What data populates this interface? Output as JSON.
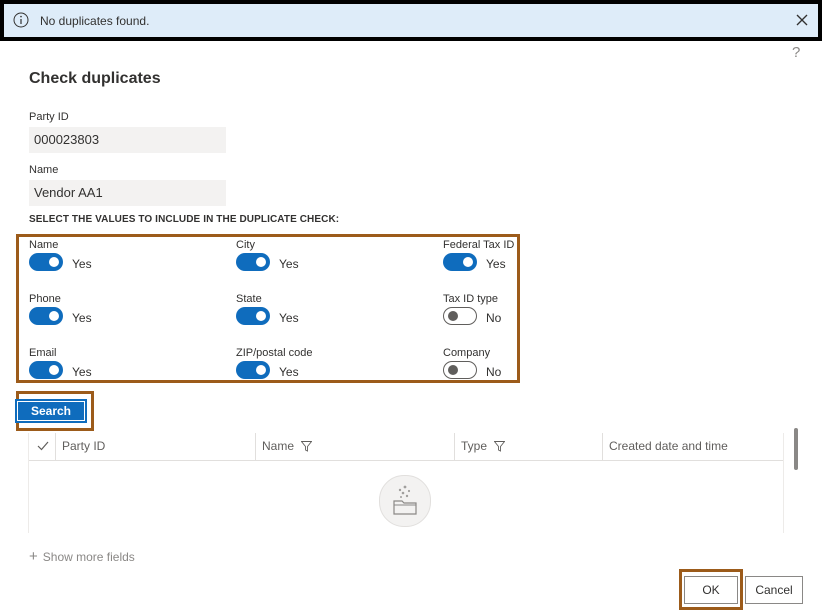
{
  "notification": {
    "text": "No duplicates found."
  },
  "help": {
    "label": "?"
  },
  "dialog": {
    "title": "Check duplicates",
    "party_id": {
      "label": "Party ID",
      "value": "000023803"
    },
    "name": {
      "label": "Name",
      "value": "Vendor AA1"
    },
    "section_label": "SELECT THE VALUES TO INCLUDE IN THE DUPLICATE CHECK:",
    "toggles": [
      {
        "label": "Name",
        "on": true,
        "value": "Yes"
      },
      {
        "label": "City",
        "on": true,
        "value": "Yes"
      },
      {
        "label": "Federal Tax ID",
        "on": true,
        "value": "Yes"
      },
      {
        "label": "Phone",
        "on": true,
        "value": "Yes"
      },
      {
        "label": "State",
        "on": true,
        "value": "Yes"
      },
      {
        "label": "Tax ID type",
        "on": false,
        "value": "No"
      },
      {
        "label": "Email",
        "on": true,
        "value": "Yes"
      },
      {
        "label": "ZIP/postal code",
        "on": true,
        "value": "Yes"
      },
      {
        "label": "Company",
        "on": false,
        "value": "No"
      }
    ],
    "search_label": "Search",
    "grid": {
      "columns": [
        "Party ID",
        "Name",
        "Type",
        "Created date and time"
      ]
    },
    "show_more": "Show more fields",
    "ok_label": "OK",
    "cancel_label": "Cancel"
  },
  "colors": {
    "accent": "#0f6cbd",
    "highlight": "#9c5b1a",
    "info_bg": "#deecf9"
  }
}
